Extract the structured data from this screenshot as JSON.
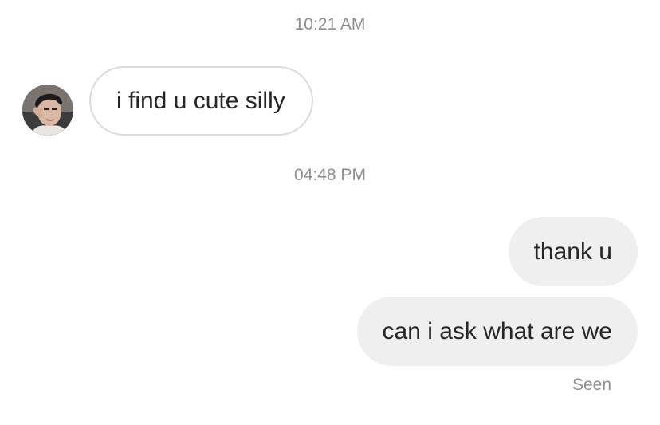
{
  "conversation": {
    "timestamps": [
      "10:21 AM",
      "04:48 PM"
    ],
    "incoming": [
      {
        "text": "i find u cute silly"
      }
    ],
    "outgoing": [
      {
        "text": "thank u"
      },
      {
        "text": "can i ask what are we"
      }
    ],
    "read_receipt": "Seen"
  },
  "colors": {
    "background": "#ffffff",
    "outgoing_bubble": "#efefef",
    "incoming_border": "#dbdbdb",
    "text": "#262626",
    "muted": "#8e8e8e"
  },
  "icons": {
    "avatar": "contact-avatar-photo"
  }
}
